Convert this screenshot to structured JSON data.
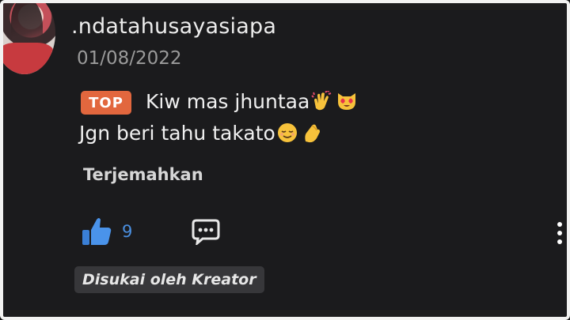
{
  "comment": {
    "username": ".ndatahusayasiapa",
    "date": "01/08/2022",
    "badge": "TOP",
    "lines": [
      "Kiw mas jhuntaa",
      "Jgn beri tahu takato"
    ],
    "emojis_line1": [
      "clapping-hands-emoji",
      "heart-eyes-cat-emoji"
    ],
    "emojis_line2": [
      "relieved-face-emoji",
      "pinched-hand-emoji"
    ],
    "translate_label": "Terjemahkan",
    "like_count": "9",
    "liked_by_label": "Disukai oleh Kreator"
  },
  "colors": {
    "badge": "#e2673e",
    "like_blue": "#4a8fe0",
    "background": "#1b1b1d"
  }
}
